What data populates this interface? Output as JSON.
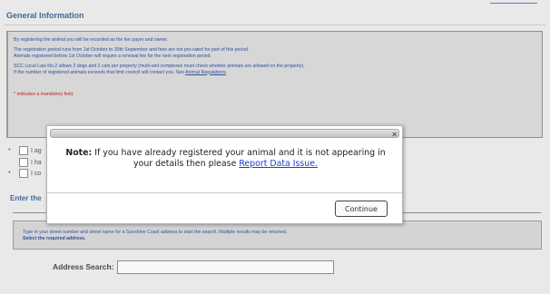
{
  "section": {
    "title": "General Information"
  },
  "info": {
    "line1": "By registering the animal you will be recorded as the fee payer and owner.",
    "line2": "The registration period runs from 1st October to 30th September and fees are not pro-rated for part of this period.",
    "line3": "Animals registered before 1st October will require a renewal fee for the next registration period.",
    "line4": "SCC Local Law No.2 allows 2 dogs and 2 cats per property (multi-unit complexes must check whether animals are allowed on the property).",
    "line5_prefix": "If the number of registered animals exceeds that limit council will contact you. See ",
    "line5_link": "Animal Regulations",
    "line5_suffix": ".",
    "mandatory_note": "* indicates a mandatory field."
  },
  "agreements": [
    {
      "star": "*",
      "text": "I ag"
    },
    {
      "star": "",
      "text": "I ha"
    },
    {
      "star": "*",
      "text": "I co"
    }
  ],
  "enter": {
    "title": "Enter the"
  },
  "search": {
    "hint": "Type in your street number and street name for a Sunshine Coast address to start the search. Multiple results may be returned.",
    "hint_bold": "Select the required address.",
    "label": "Address Search:",
    "value": ""
  },
  "modal": {
    "close": "×",
    "note_label": "Note:",
    "message": " If you have already registered your animal and it is not appearing in your details then please ",
    "link": "Report Data Issue.",
    "button": "Continue"
  },
  "colors": {
    "heading": "#3f6b98",
    "info_text": "#2f4f9e",
    "mandatory": "#c0272d",
    "link": "#1a3fd0"
  }
}
